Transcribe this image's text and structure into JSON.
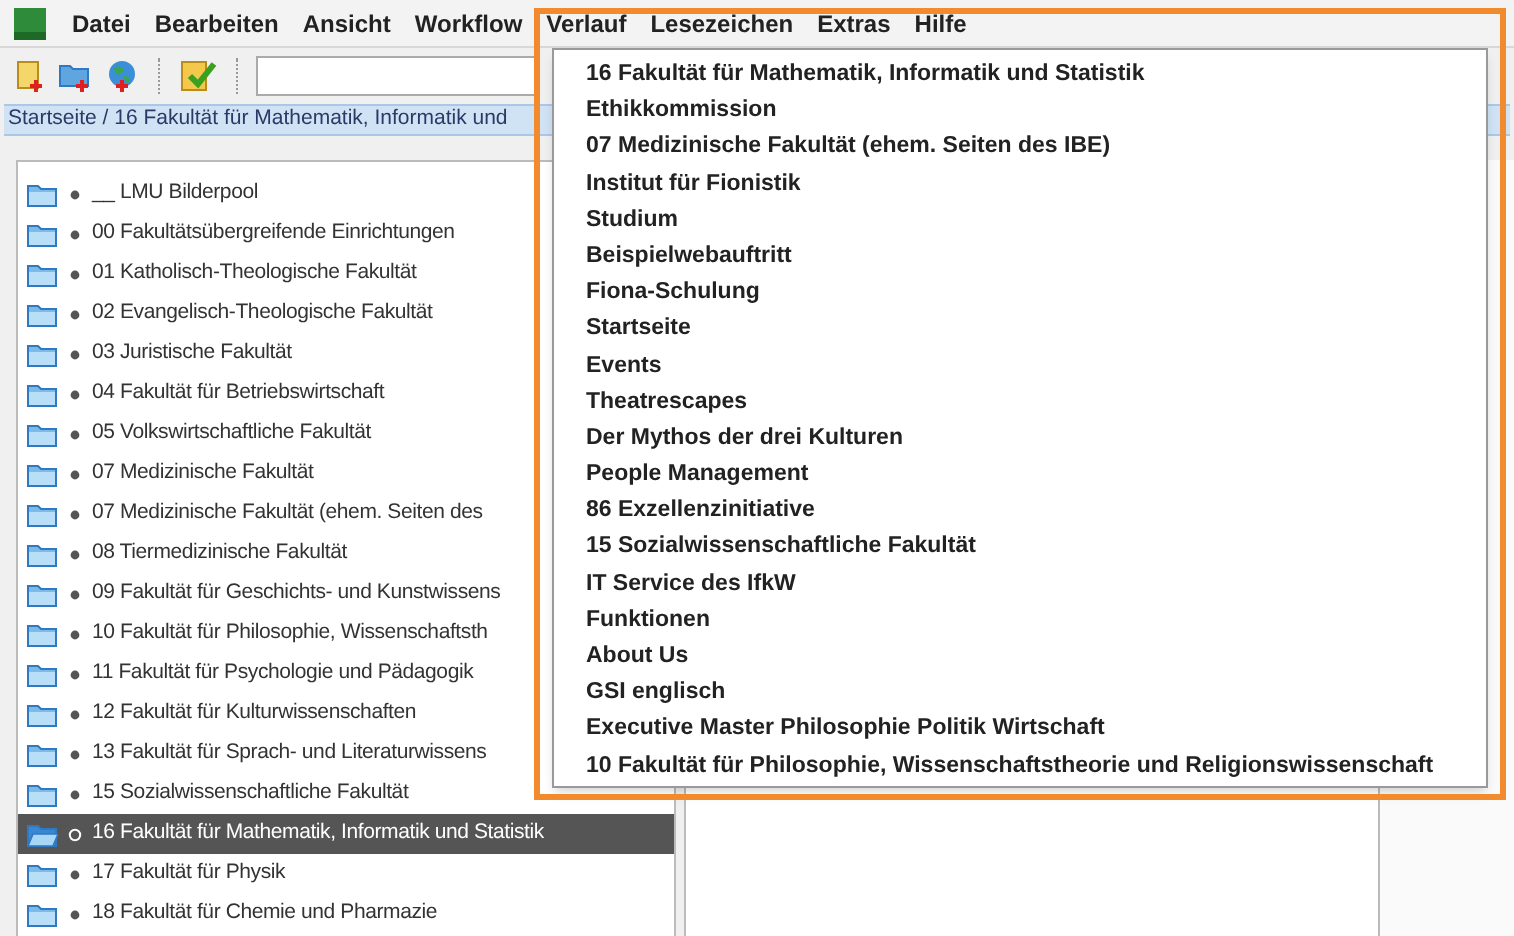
{
  "menubar": {
    "items": [
      "Datei",
      "Bearbeiten",
      "Ansicht",
      "Workflow",
      "Verlauf",
      "Lesezeichen",
      "Extras",
      "Hilfe"
    ]
  },
  "breadcrumb": "Startseite / 16 Fakultät für Mathematik, Informatik und",
  "tree": {
    "items": [
      {
        "label": "__ LMU Bilderpool",
        "selected": false
      },
      {
        "label": "00 Fakultätsübergreifende Einrichtungen",
        "selected": false
      },
      {
        "label": "01 Katholisch-Theologische Fakultät",
        "selected": false
      },
      {
        "label": "02 Evangelisch-Theologische Fakultät",
        "selected": false
      },
      {
        "label": "03 Juristische Fakultät",
        "selected": false
      },
      {
        "label": "04 Fakultät für Betriebswirtschaft",
        "selected": false
      },
      {
        "label": "05 Volkswirtschaftliche Fakultät",
        "selected": false
      },
      {
        "label": "07 Medizinische Fakultät",
        "selected": false
      },
      {
        "label": "07 Medizinische Fakultät (ehem. Seiten des",
        "selected": false
      },
      {
        "label": "08 Tiermedizinische Fakultät",
        "selected": false
      },
      {
        "label": "09 Fakultät für Geschichts- und Kunstwissens",
        "selected": false
      },
      {
        "label": "10 Fakultät für Philosophie, Wissenschaftsth",
        "selected": false
      },
      {
        "label": "11 Fakultät für Psychologie und Pädagogik",
        "selected": false
      },
      {
        "label": "12 Fakultät für Kulturwissenschaften",
        "selected": false
      },
      {
        "label": "13 Fakultät für Sprach- und Literaturwissens",
        "selected": false
      },
      {
        "label": "15 Sozialwissenschaftliche Fakultät",
        "selected": false
      },
      {
        "label": "16 Fakultät für Mathematik, Informatik und Statistik",
        "selected": true
      },
      {
        "label": "17 Fakultät für Physik",
        "selected": false
      },
      {
        "label": "18 Fakultät für Chemie und Pharmazie",
        "selected": false
      }
    ]
  },
  "history_menu": {
    "items": [
      "16 Fakultät für Mathematik, Informatik und Statistik",
      "Ethikkommission",
      "07 Medizinische Fakultät (ehem. Seiten des IBE)",
      "Institut für Fionistik",
      "Studium",
      "Beispielwebauftritt",
      "Fiona-Schulung",
      "Startseite",
      "Events",
      "Theatrescapes",
      "Der Mythos der drei Kulturen",
      "People Management",
      "86 Exzellenzinitiative",
      "15 Sozialwissenschaftliche Fakultät",
      "IT Service des IfkW",
      "Funktionen",
      "About Us",
      "GSI englisch",
      "Executive Master Philosophie Politik Wirtschaft",
      "10 Fakultät für Philosophie, Wissenschaftstheorie und Religionswissenschaft"
    ]
  }
}
